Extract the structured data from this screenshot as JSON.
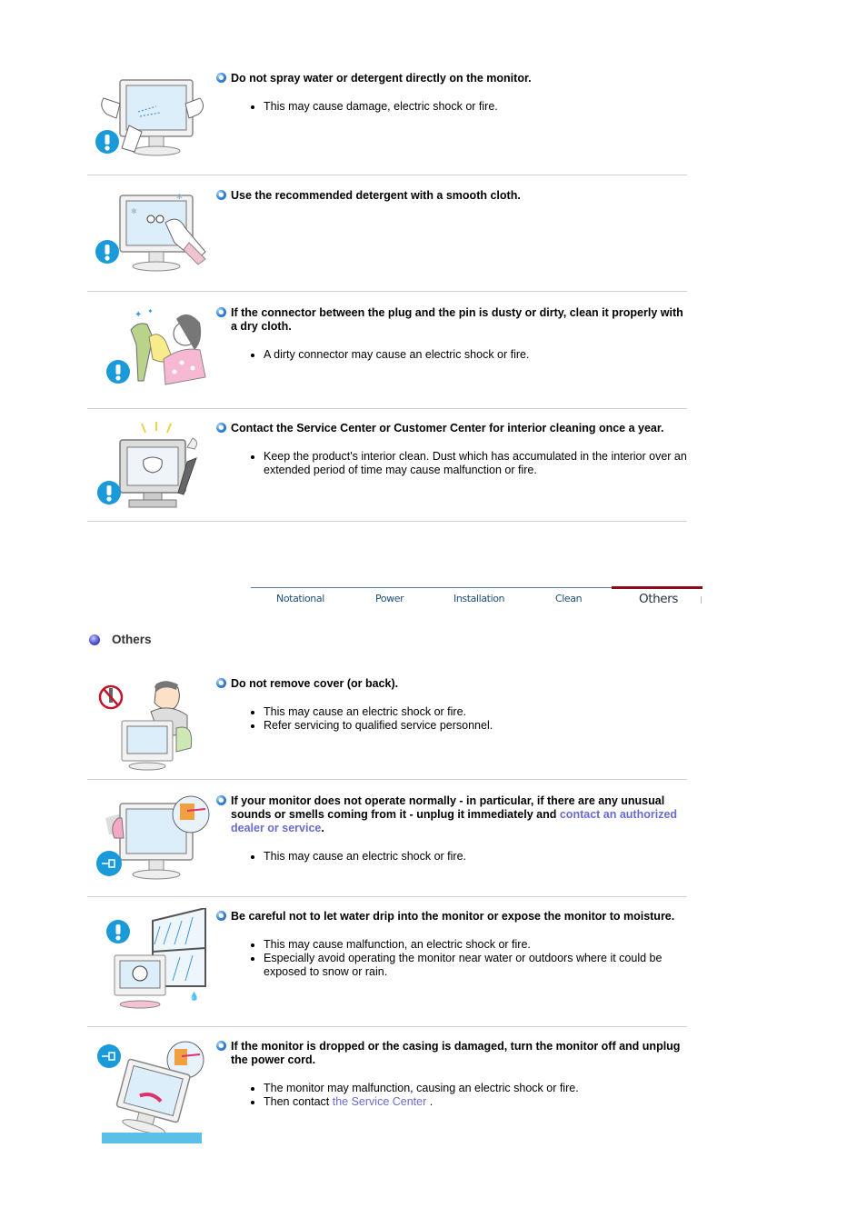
{
  "clean_items": [
    {
      "heading": "Do not spray water or detergent directly on the monitor.",
      "bullets": [
        "This may cause damage, electric shock or fire."
      ],
      "illustration": "monitor-spray-warning-illustration"
    },
    {
      "heading": "Use the recommended detergent with a smooth cloth.",
      "bullets": [],
      "illustration": "monitor-cloth-cleaning-illustration"
    },
    {
      "heading": "If the connector between the plug and the pin is dusty or dirty, clean it properly with a dry cloth.",
      "bullets": [
        "A dirty connector may cause an electric shock or fire."
      ],
      "illustration": "plug-cleaning-illustration"
    },
    {
      "heading": "Contact the Service Center or Customer Center for interior cleaning once a year.",
      "bullets": [
        "Keep the product's interior clean. Dust which has accumulated in the interior over an extended period of time may cause malfunction or fire."
      ],
      "illustration": "interior-cleaning-illustration"
    }
  ],
  "tabs": [
    {
      "label": "Notational",
      "active": false
    },
    {
      "label": "Power",
      "active": false
    },
    {
      "label": "Installation",
      "active": false
    },
    {
      "label": "Clean",
      "active": false
    },
    {
      "label": "Others",
      "active": true
    }
  ],
  "section_title": "Others",
  "others_items": [
    {
      "heading": "Do not remove cover (or back).",
      "bullets": [
        "This may cause an electric shock or fire.",
        "Refer servicing to qualified service personnel."
      ],
      "illustration": "remove-cover-prohibited-illustration"
    },
    {
      "heading_pre": "If your monitor does not operate normally - in particular, if there are any unusual sounds or smells coming from it - unplug it immediately and ",
      "heading_link": "contact an authorized dealer or service",
      "heading_post": ".",
      "bullets": [
        "This may cause an electric shock or fire."
      ],
      "illustration": "unplug-abnormal-monitor-illustration"
    },
    {
      "heading": "Be careful not to let water drip into the monitor or expose the monitor to moisture.",
      "bullets": [
        "This may cause malfunction, an electric shock or fire.",
        "Especially avoid operating the monitor near water or outdoors where it could be exposed to snow or rain."
      ],
      "illustration": "monitor-rain-moisture-illustration"
    },
    {
      "heading": "If the monitor is dropped or the casing is damaged, turn the monitor off and unplug the power cord.",
      "bullets": [
        "The monitor may malfunction, causing an electric shock or fire."
      ],
      "bullet2_pre": "Then contact ",
      "bullet2_link": "the Service Center",
      "bullet2_post": " .",
      "illustration": "dropped-monitor-illustration"
    }
  ],
  "colors": {
    "link": "#6a6ad0",
    "active_tab_bar": "#8b0a1e",
    "warning_blue": "#1a9ad8"
  }
}
